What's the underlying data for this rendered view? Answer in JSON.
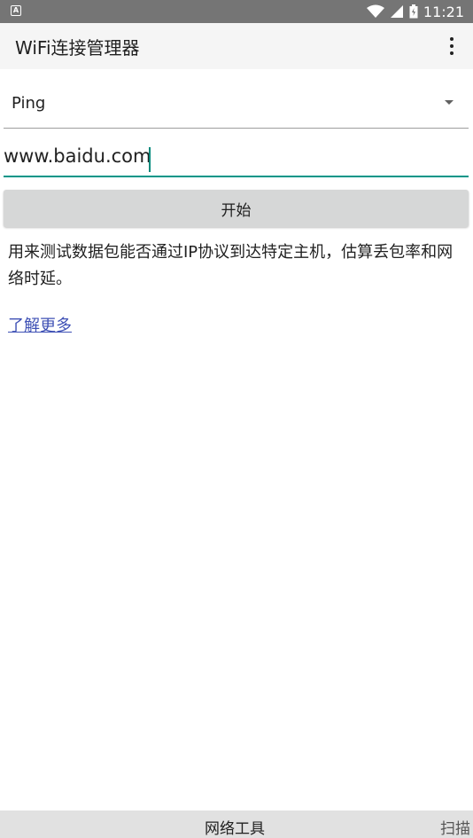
{
  "status_bar": {
    "time": "11:21",
    "left_icon": "notification-a-icon",
    "icons": [
      "wifi-icon",
      "signal-icon",
      "battery-icon"
    ]
  },
  "app_bar": {
    "title": "WiFi连接管理器",
    "menu_icon": "more-vert-icon"
  },
  "tool_select": {
    "selected": "Ping"
  },
  "host_input": {
    "value": "www.baidu.com"
  },
  "start_button": {
    "label": "开始"
  },
  "description": "用来测试数据包能否通过IP协议到达特定主机，估算丢包率和网络时延。",
  "learn_more": "了解更多",
  "tabs": [
    {
      "label": "网络工具"
    },
    {
      "label": "扫描"
    }
  ],
  "colors": {
    "accent": "#009688",
    "link": "#3f51b5",
    "status_bar": "#757575"
  }
}
